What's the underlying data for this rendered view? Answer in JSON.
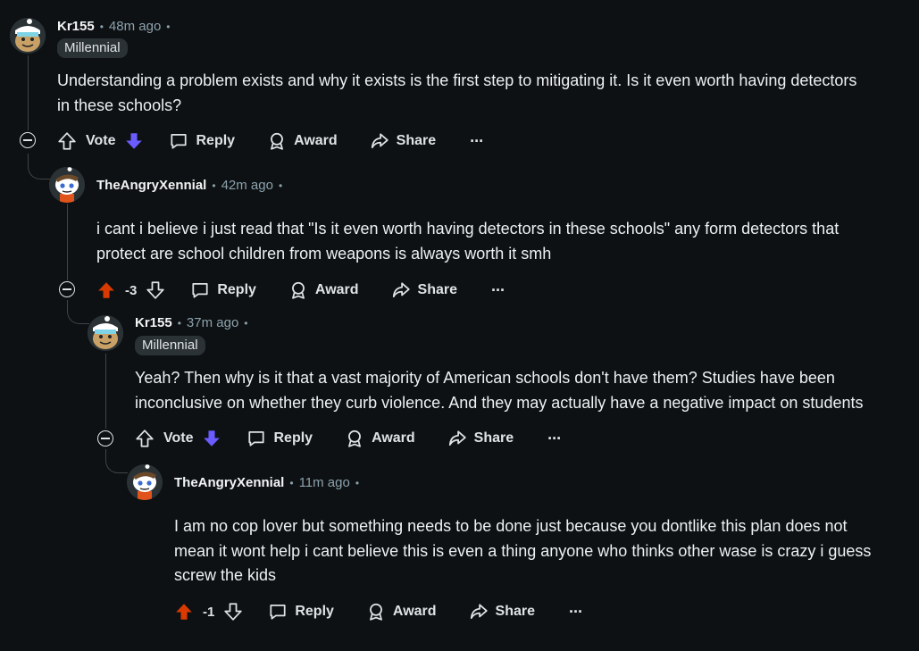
{
  "comments": [
    {
      "author": "Kr155",
      "time": "48m ago",
      "flair": "Millennial",
      "body_lines": [
        "Understanding a problem exists and why it exists is the first step to mitigating it. Is it even worth having detectors",
        "in these schools?"
      ],
      "vote_label": "Vote",
      "reply": "Reply",
      "award": "Award",
      "share": "Share",
      "more": "···"
    },
    {
      "author": "TheAngryXennial",
      "time": "42m ago",
      "body_lines": [
        "i cant i believe i just read that \"Is it even worth having detectors in these schools\" any form detectors that",
        "protect are school children from weapons is always worth it smh"
      ],
      "score": "-3",
      "reply": "Reply",
      "award": "Award",
      "share": "Share",
      "more": "···"
    },
    {
      "author": "Kr155",
      "time": "37m ago",
      "flair": "Millennial",
      "body_lines": [
        "Yeah? Then why is it that a vast majority of American schools don't have them? Studies have been",
        "inconclusive on whether they curb violence. And they may actually have a negative impact on students"
      ],
      "vote_label": "Vote",
      "reply": "Reply",
      "award": "Award",
      "share": "Share",
      "more": "···"
    },
    {
      "author": "TheAngryXennial",
      "time": "11m ago",
      "body_lines": [
        "I am no cop lover but something needs to be done just because you dontlike this plan does not",
        "mean it wont help i cant believe this is even a thing anyone who thinks other wase is crazy i guess",
        "screw the kids"
      ],
      "score": "-1",
      "reply": "Reply",
      "award": "Award",
      "share": "Share",
      "more": "···"
    }
  ],
  "colors": {
    "background": "#0e1113",
    "upvote_active": "#d93a00",
    "downvote_active": "#6a5cff",
    "meta": "#8ba2ad"
  },
  "separator": "•"
}
